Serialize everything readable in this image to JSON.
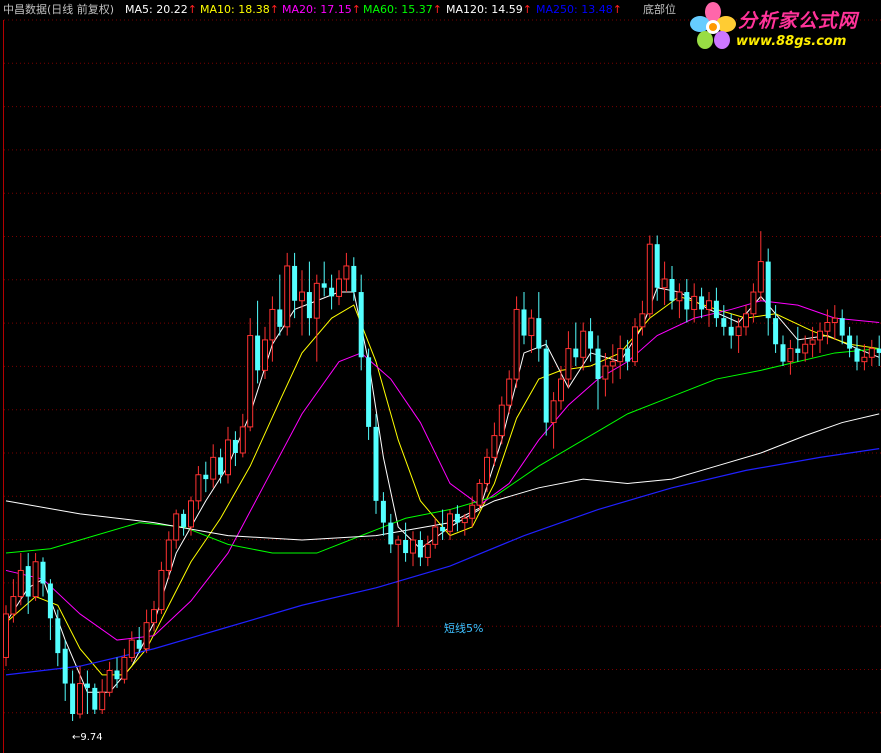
{
  "header": {
    "title": "中昌数据(日线 前复权)",
    "ma_items": [
      {
        "label": "MA5: 20.22",
        "color": "#ffffff"
      },
      {
        "label": "MA10: 18.38",
        "color": "#ffff00"
      },
      {
        "label": "MA20: 17.15",
        "color": "#ff00ff"
      },
      {
        "label": "MA60: 15.37",
        "color": "#00ff00"
      },
      {
        "label": "MA120: 14.59",
        "color": "#ffffff"
      },
      {
        "label": "MA250: 13.48",
        "color": "#0000ff"
      }
    ],
    "indicator_name": "底部位",
    "arrow_glyph": "↑",
    "arrow_color": "#ff2020"
  },
  "logo": {
    "name": "分析家公式网",
    "url": "www.88gs.com"
  },
  "annotations": {
    "low_label": "←9.74",
    "signal_label": "短线5%"
  },
  "chart_data": {
    "type": "candlestick",
    "title": "中昌数据(日线 前复权)",
    "ylim": [
      9.0,
      31.5
    ],
    "grid": "horizontal dashed",
    "up_color": "#ff3232",
    "down_color": "#54ffff",
    "candles": [
      [
        11.2,
        12.4,
        11.0,
        12.2
      ],
      [
        12.2,
        13.0,
        12.0,
        12.6
      ],
      [
        12.6,
        13.6,
        12.4,
        13.2
      ],
      [
        13.3,
        13.6,
        12.2,
        12.6
      ],
      [
        12.6,
        13.6,
        12.5,
        13.4
      ],
      [
        13.4,
        13.5,
        12.6,
        12.9
      ],
      [
        12.9,
        13.0,
        11.6,
        12.1
      ],
      [
        12.1,
        12.3,
        11.0,
        11.3
      ],
      [
        11.4,
        11.6,
        10.2,
        10.6
      ],
      [
        10.6,
        10.9,
        9.74,
        9.9
      ],
      [
        9.9,
        11.0,
        9.8,
        10.6
      ],
      [
        10.6,
        10.9,
        9.9,
        10.5
      ],
      [
        10.5,
        10.6,
        9.9,
        10.0
      ],
      [
        10.0,
        10.7,
        9.9,
        10.4
      ],
      [
        10.4,
        11.1,
        10.3,
        10.9
      ],
      [
        10.9,
        11.2,
        10.5,
        10.7
      ],
      [
        10.7,
        11.4,
        10.6,
        11.2
      ],
      [
        11.2,
        11.8,
        11.1,
        11.6
      ],
      [
        11.6,
        11.9,
        11.3,
        11.4
      ],
      [
        11.4,
        12.3,
        11.3,
        12.0
      ],
      [
        12.0,
        12.5,
        11.8,
        12.3
      ],
      [
        12.3,
        13.4,
        12.2,
        13.2
      ],
      [
        13.2,
        14.1,
        13.0,
        13.9
      ],
      [
        13.9,
        14.6,
        13.7,
        14.5
      ],
      [
        14.5,
        14.6,
        14.0,
        14.2
      ],
      [
        14.2,
        14.9,
        14.0,
        14.8
      ],
      [
        14.8,
        15.6,
        14.6,
        15.4
      ],
      [
        15.4,
        15.7,
        15.0,
        15.3
      ],
      [
        15.3,
        16.1,
        15.1,
        15.8
      ],
      [
        15.8,
        16.0,
        15.2,
        15.4
      ],
      [
        15.4,
        16.5,
        15.2,
        16.2
      ],
      [
        16.2,
        16.4,
        15.6,
        15.9
      ],
      [
        15.9,
        16.8,
        15.8,
        16.5
      ],
      [
        16.5,
        19.0,
        16.4,
        18.6
      ],
      [
        18.6,
        19.4,
        17.5,
        17.8
      ],
      [
        17.8,
        18.8,
        17.6,
        18.5
      ],
      [
        18.5,
        19.5,
        18.0,
        19.2
      ],
      [
        19.2,
        20.0,
        18.6,
        18.8
      ],
      [
        18.8,
        20.5,
        18.6,
        20.2
      ],
      [
        20.2,
        20.5,
        19.0,
        19.4
      ],
      [
        19.4,
        20.1,
        18.6,
        19.6
      ],
      [
        19.6,
        20.3,
        18.6,
        19.0
      ],
      [
        19.0,
        20.0,
        18.0,
        19.8
      ],
      [
        19.8,
        20.3,
        19.5,
        19.7
      ],
      [
        19.7,
        20.0,
        19.2,
        19.5
      ],
      [
        19.5,
        20.1,
        19.3,
        19.9
      ],
      [
        19.9,
        20.5,
        19.6,
        20.2
      ],
      [
        20.2,
        20.4,
        19.4,
        19.6
      ],
      [
        19.6,
        20.0,
        17.8,
        18.1
      ],
      [
        18.1,
        18.3,
        16.2,
        16.5
      ],
      [
        16.5,
        16.8,
        14.5,
        14.8
      ],
      [
        14.8,
        15.0,
        14.0,
        14.3
      ],
      [
        14.3,
        14.5,
        13.6,
        13.8
      ],
      [
        13.8,
        14.0,
        11.9,
        13.9
      ],
      [
        13.9,
        14.3,
        13.4,
        13.6
      ],
      [
        13.6,
        14.1,
        13.3,
        13.9
      ],
      [
        13.9,
        14.1,
        13.3,
        13.5
      ],
      [
        13.5,
        14.0,
        13.3,
        13.8
      ],
      [
        13.8,
        14.4,
        13.7,
        14.2
      ],
      [
        14.2,
        14.6,
        13.9,
        14.1
      ],
      [
        14.1,
        14.6,
        13.9,
        14.5
      ],
      [
        14.5,
        14.7,
        14.1,
        14.3
      ],
      [
        14.3,
        14.5,
        14.0,
        14.4
      ],
      [
        14.4,
        14.9,
        14.2,
        14.7
      ],
      [
        14.7,
        15.3,
        14.6,
        15.2
      ],
      [
        15.2,
        16.0,
        15.0,
        15.8
      ],
      [
        15.8,
        16.6,
        15.6,
        16.3
      ],
      [
        16.3,
        17.2,
        16.1,
        17.0
      ],
      [
        17.0,
        17.8,
        16.8,
        17.6
      ],
      [
        17.6,
        19.5,
        17.4,
        19.2
      ],
      [
        19.2,
        19.6,
        18.4,
        18.6
      ],
      [
        18.6,
        19.2,
        18.2,
        19.0
      ],
      [
        19.0,
        19.6,
        18.0,
        18.3
      ],
      [
        18.3,
        18.5,
        16.3,
        16.6
      ],
      [
        16.6,
        17.3,
        16.0,
        17.1
      ],
      [
        17.1,
        17.9,
        16.9,
        17.6
      ],
      [
        17.6,
        18.7,
        17.4,
        18.3
      ],
      [
        18.3,
        18.9,
        17.9,
        18.1
      ],
      [
        18.1,
        18.9,
        17.8,
        18.7
      ],
      [
        18.7,
        19.0,
        18.0,
        18.3
      ],
      [
        18.3,
        18.6,
        16.9,
        17.6
      ],
      [
        17.6,
        18.2,
        17.2,
        17.9
      ],
      [
        17.9,
        18.4,
        17.5,
        18.0
      ],
      [
        18.0,
        18.6,
        17.6,
        18.3
      ],
      [
        18.3,
        18.5,
        17.8,
        18.0
      ],
      [
        18.0,
        19.0,
        17.9,
        18.8
      ],
      [
        18.8,
        19.4,
        18.6,
        19.1
      ],
      [
        19.1,
        20.9,
        19.0,
        20.7
      ],
      [
        20.7,
        20.9,
        19.4,
        19.7
      ],
      [
        19.7,
        20.3,
        19.3,
        19.9
      ],
      [
        19.9,
        20.2,
        19.2,
        19.4
      ],
      [
        19.4,
        19.8,
        19.0,
        19.6
      ],
      [
        19.6,
        19.9,
        18.9,
        19.2
      ],
      [
        19.2,
        19.8,
        18.9,
        19.5
      ],
      [
        19.5,
        19.7,
        19.0,
        19.2
      ],
      [
        19.2,
        19.6,
        18.8,
        19.4
      ],
      [
        19.4,
        19.7,
        18.8,
        19.0
      ],
      [
        19.0,
        19.3,
        18.6,
        18.8
      ],
      [
        18.8,
        19.1,
        18.3,
        18.6
      ],
      [
        18.6,
        19.0,
        18.2,
        18.8
      ],
      [
        18.8,
        19.3,
        18.6,
        19.1
      ],
      [
        19.1,
        19.8,
        18.9,
        19.6
      ],
      [
        19.6,
        21.0,
        19.4,
        20.3
      ],
      [
        20.3,
        20.6,
        18.6,
        19.0
      ],
      [
        19.0,
        19.3,
        18.2,
        18.4
      ],
      [
        18.4,
        18.6,
        17.9,
        18.0
      ],
      [
        18.0,
        18.5,
        17.7,
        18.3
      ],
      [
        18.3,
        18.8,
        18.0,
        18.2
      ],
      [
        18.2,
        18.6,
        18.0,
        18.4
      ],
      [
        18.4,
        18.8,
        18.1,
        18.5
      ],
      [
        18.5,
        18.9,
        18.2,
        18.7
      ],
      [
        18.7,
        19.2,
        18.4,
        18.9
      ],
      [
        18.9,
        19.3,
        18.5,
        19.0
      ],
      [
        19.0,
        19.2,
        18.4,
        18.6
      ],
      [
        18.6,
        18.8,
        18.1,
        18.3
      ],
      [
        18.3,
        18.6,
        17.8,
        18.0
      ],
      [
        18.0,
        18.4,
        17.8,
        18.1
      ],
      [
        18.1,
        18.5,
        17.9,
        18.3
      ],
      [
        18.3,
        18.6,
        17.9,
        18.2
      ]
    ],
    "moving_averages": [
      {
        "name": "MA5",
        "color": "#ffffff",
        "width": 1,
        "points": [
          [
            0,
            12.0
          ],
          [
            3,
            12.8
          ],
          [
            5,
            13.0
          ],
          [
            8,
            11.6
          ],
          [
            11,
            10.4
          ],
          [
            14,
            10.4
          ],
          [
            17,
            11.0
          ],
          [
            20,
            12.0
          ],
          [
            23,
            13.6
          ],
          [
            27,
            14.8
          ],
          [
            30,
            15.6
          ],
          [
            33,
            16.8
          ],
          [
            36,
            18.4
          ],
          [
            39,
            19.2
          ],
          [
            42,
            19.4
          ],
          [
            45,
            19.6
          ],
          [
            47,
            19.6
          ],
          [
            49,
            18.0
          ],
          [
            51,
            15.8
          ],
          [
            53,
            14.2
          ],
          [
            56,
            13.7
          ],
          [
            60,
            14.2
          ],
          [
            64,
            14.6
          ],
          [
            67,
            16.2
          ],
          [
            70,
            18.2
          ],
          [
            73,
            18.4
          ],
          [
            76,
            17.4
          ],
          [
            79,
            18.2
          ],
          [
            83,
            18.0
          ],
          [
            86,
            18.8
          ],
          [
            88,
            19.7
          ],
          [
            91,
            19.6
          ],
          [
            95,
            19.2
          ],
          [
            99,
            18.9
          ],
          [
            102,
            19.5
          ],
          [
            104,
            19.1
          ],
          [
            107,
            18.5
          ],
          [
            111,
            18.6
          ],
          [
            115,
            18.3
          ],
          [
            118,
            18.1
          ]
        ]
      },
      {
        "name": "MA10",
        "color": "#ffff00",
        "width": 1,
        "points": [
          [
            0,
            12.0
          ],
          [
            4,
            12.6
          ],
          [
            7,
            12.4
          ],
          [
            10,
            11.4
          ],
          [
            13,
            10.8
          ],
          [
            16,
            10.8
          ],
          [
            19,
            11.4
          ],
          [
            22,
            12.4
          ],
          [
            25,
            13.4
          ],
          [
            29,
            14.4
          ],
          [
            33,
            15.6
          ],
          [
            37,
            17.1
          ],
          [
            40,
            18.2
          ],
          [
            44,
            19.0
          ],
          [
            47,
            19.3
          ],
          [
            50,
            18.0
          ],
          [
            53,
            16.2
          ],
          [
            56,
            14.8
          ],
          [
            60,
            14.0
          ],
          [
            63,
            14.2
          ],
          [
            66,
            15.2
          ],
          [
            69,
            16.7
          ],
          [
            72,
            17.6
          ],
          [
            75,
            17.8
          ],
          [
            79,
            17.9
          ],
          [
            83,
            18.2
          ],
          [
            87,
            19.0
          ],
          [
            91,
            19.5
          ],
          [
            96,
            19.2
          ],
          [
            100,
            19.0
          ],
          [
            104,
            19.1
          ],
          [
            109,
            18.7
          ],
          [
            114,
            18.4
          ],
          [
            118,
            18.3
          ]
        ]
      },
      {
        "name": "MA20",
        "color": "#ff00ff",
        "width": 1,
        "points": [
          [
            0,
            13.2
          ],
          [
            5,
            13.0
          ],
          [
            10,
            12.2
          ],
          [
            15,
            11.6
          ],
          [
            20,
            11.7
          ],
          [
            25,
            12.5
          ],
          [
            30,
            13.6
          ],
          [
            35,
            15.2
          ],
          [
            40,
            16.8
          ],
          [
            45,
            18.0
          ],
          [
            48,
            18.2
          ],
          [
            52,
            17.6
          ],
          [
            56,
            16.6
          ],
          [
            60,
            15.2
          ],
          [
            64,
            14.7
          ],
          [
            68,
            15.2
          ],
          [
            72,
            16.2
          ],
          [
            76,
            17.0
          ],
          [
            80,
            17.6
          ],
          [
            84,
            18.0
          ],
          [
            88,
            18.6
          ],
          [
            93,
            19.0
          ],
          [
            98,
            19.2
          ],
          [
            102,
            19.4
          ],
          [
            107,
            19.3
          ],
          [
            112,
            19.0
          ],
          [
            118,
            18.9
          ]
        ]
      },
      {
        "name": "MA60",
        "color": "#00ff00",
        "width": 1,
        "points": [
          [
            0,
            13.6
          ],
          [
            6,
            13.7
          ],
          [
            12,
            14.0
          ],
          [
            18,
            14.3
          ],
          [
            24,
            14.2
          ],
          [
            30,
            13.8
          ],
          [
            36,
            13.6
          ],
          [
            42,
            13.6
          ],
          [
            48,
            14.0
          ],
          [
            54,
            14.4
          ],
          [
            60,
            14.6
          ],
          [
            66,
            14.9
          ],
          [
            72,
            15.6
          ],
          [
            78,
            16.2
          ],
          [
            84,
            16.8
          ],
          [
            90,
            17.2
          ],
          [
            96,
            17.6
          ],
          [
            102,
            17.8
          ],
          [
            107,
            18.0
          ],
          [
            112,
            18.2
          ],
          [
            118,
            18.3
          ]
        ]
      },
      {
        "name": "MA120",
        "color": "#ffffff",
        "width": 1,
        "points": [
          [
            0,
            14.8
          ],
          [
            10,
            14.5
          ],
          [
            20,
            14.3
          ],
          [
            30,
            14.0
          ],
          [
            40,
            13.9
          ],
          [
            50,
            14.0
          ],
          [
            60,
            14.3
          ],
          [
            66,
            14.8
          ],
          [
            72,
            15.1
          ],
          [
            78,
            15.3
          ],
          [
            84,
            15.2
          ],
          [
            90,
            15.3
          ],
          [
            96,
            15.6
          ],
          [
            102,
            15.9
          ],
          [
            108,
            16.3
          ],
          [
            113,
            16.6
          ],
          [
            118,
            16.8
          ]
        ]
      },
      {
        "name": "MA250",
        "color": "#2020ff",
        "width": 1.2,
        "points": [
          [
            0,
            10.8
          ],
          [
            10,
            11.0
          ],
          [
            20,
            11.4
          ],
          [
            30,
            11.9
          ],
          [
            40,
            12.4
          ],
          [
            50,
            12.8
          ],
          [
            60,
            13.3
          ],
          [
            70,
            14.0
          ],
          [
            80,
            14.6
          ],
          [
            90,
            15.1
          ],
          [
            100,
            15.5
          ],
          [
            110,
            15.8
          ],
          [
            118,
            16.0
          ]
        ]
      }
    ]
  }
}
